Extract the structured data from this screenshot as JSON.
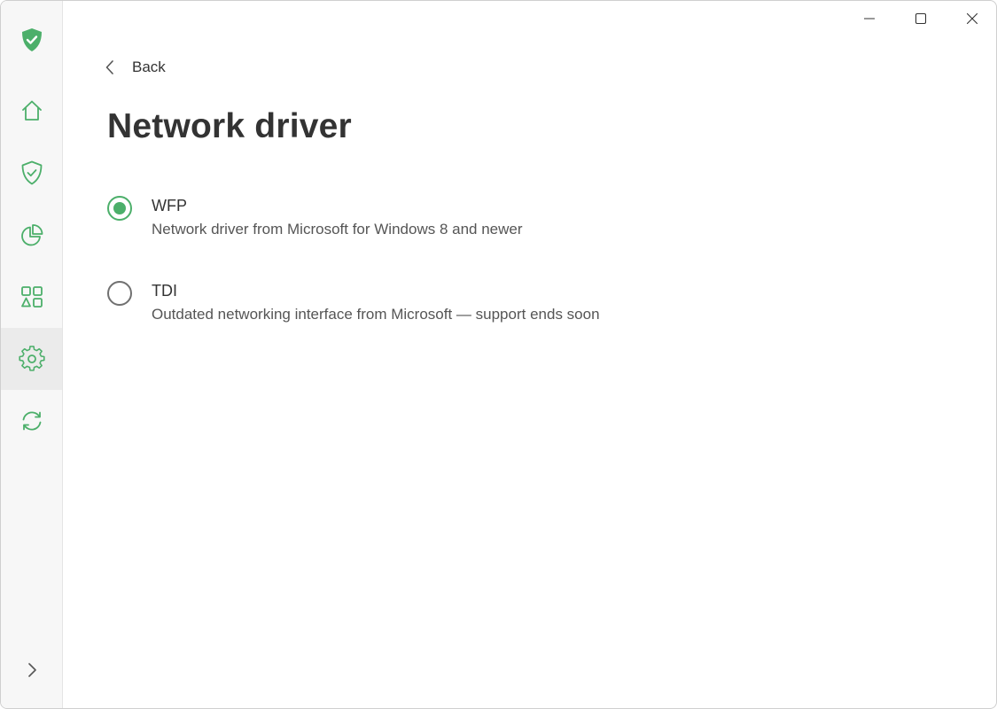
{
  "colors": {
    "accent": "#4caf6a",
    "text": "#333333",
    "muted": "#555555",
    "sidebar_bg": "#f7f7f7",
    "active_bg": "#ebebeb"
  },
  "sidebar": {
    "logo_icon": "shield-check-icon",
    "items": [
      {
        "id": "home",
        "icon": "home-icon",
        "active": false
      },
      {
        "id": "protection",
        "icon": "shield-check-icon",
        "active": false
      },
      {
        "id": "statistics",
        "icon": "pie-chart-icon",
        "active": false
      },
      {
        "id": "apps",
        "icon": "shapes-icon",
        "active": false
      },
      {
        "id": "settings",
        "icon": "gear-icon",
        "active": true
      },
      {
        "id": "updates",
        "icon": "refresh-icon",
        "active": false
      }
    ],
    "expand_icon": "chevron-right-icon"
  },
  "window_controls": {
    "minimize": "minimize-icon",
    "maximize": "maximize-icon",
    "close": "close-icon"
  },
  "main": {
    "back_label": "Back",
    "title": "Network driver",
    "options": [
      {
        "title": "WFP",
        "description": "Network driver from Microsoft for Windows 8 and newer",
        "selected": true
      },
      {
        "title": "TDI",
        "description": "Outdated networking interface from Microsoft — support ends soon",
        "selected": false
      }
    ]
  }
}
